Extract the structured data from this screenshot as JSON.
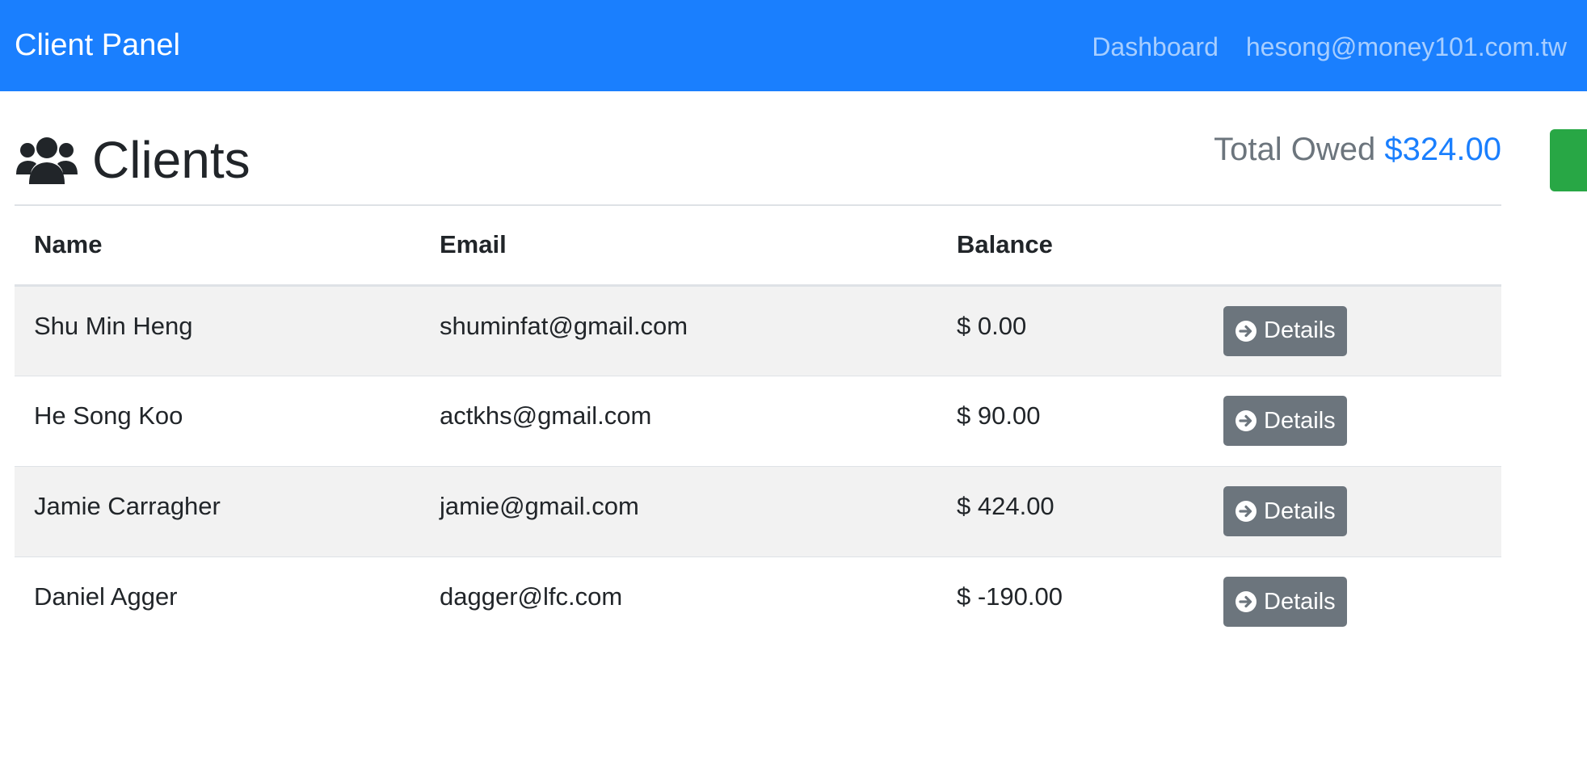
{
  "navbar": {
    "brand": "Client Panel",
    "links": [
      {
        "label": "Dashboard"
      },
      {
        "label": "hesong@money101.com.tw"
      }
    ]
  },
  "page": {
    "icon": "users-icon",
    "title": "Clients",
    "total_label": "Total Owed",
    "total_value": "$324.00"
  },
  "table": {
    "headers": {
      "name": "Name",
      "email": "Email",
      "balance": "Balance"
    },
    "rows": [
      {
        "name": "Shu Min Heng",
        "email": "shuminfat@gmail.com",
        "balance": "$ 0.00",
        "action_label": "Details"
      },
      {
        "name": "He Song Koo",
        "email": "actkhs@gmail.com",
        "balance": "$ 90.00",
        "action_label": "Details"
      },
      {
        "name": "Jamie Carragher",
        "email": "jamie@gmail.com",
        "balance": "$ 424.00",
        "action_label": "Details"
      },
      {
        "name": "Daniel Agger",
        "email": "dagger@lfc.com",
        "balance": "$ -190.00",
        "action_label": "Details"
      }
    ]
  },
  "colors": {
    "navbar": "#1a7ffe",
    "accent": "#1a7ffe",
    "secondary_button": "#6c757d",
    "success_button": "#28a745",
    "stripe": "#f2f2f2"
  }
}
